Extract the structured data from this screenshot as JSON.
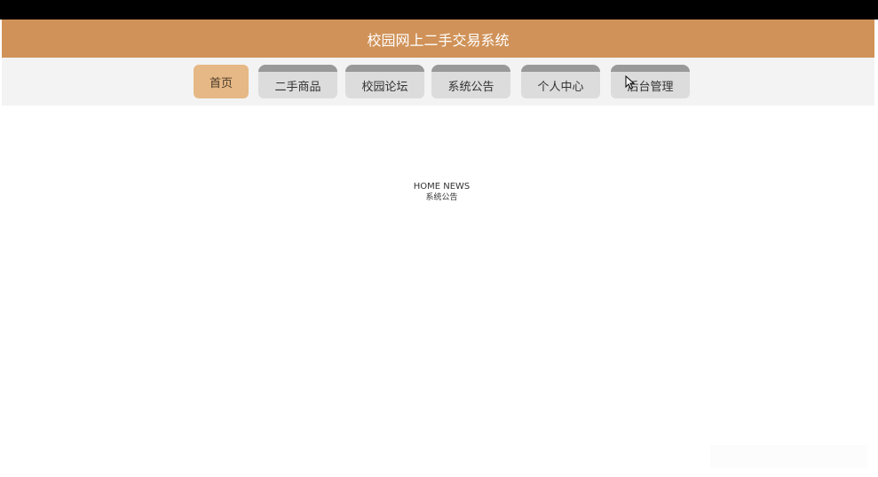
{
  "header": {
    "title": "校园网上二手交易系统"
  },
  "nav": {
    "items": [
      {
        "label": "首页",
        "active": true
      },
      {
        "label": "二手商品",
        "active": false
      },
      {
        "label": "校园论坛",
        "active": false
      },
      {
        "label": "系统公告",
        "active": false
      },
      {
        "label": "个人中心",
        "active": false
      },
      {
        "label": "后台管理",
        "active": false
      }
    ]
  },
  "section": {
    "title_en": "HOME NEWS",
    "title_cn": "系统公告"
  },
  "colors": {
    "banner": "#d09258",
    "active_tab": "#e6b885",
    "inactive_tab": "#dcdcdc",
    "tab_top_border": "#999999",
    "nav_strip": "#f3f3f3"
  },
  "icons": {
    "cursor": "mouse-pointer-icon"
  }
}
